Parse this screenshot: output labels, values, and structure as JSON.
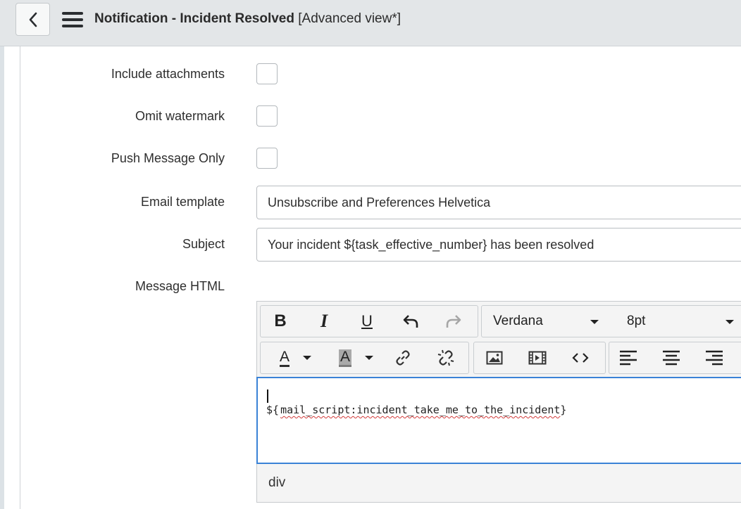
{
  "header": {
    "title": "Notification - Incident Resolved",
    "view": "[Advanced view*]",
    "back_icon": "chevron-left-icon",
    "menu_icon": "hamburger-menu-icon"
  },
  "form": {
    "include_attachments": {
      "label": "Include attachments",
      "checked": false
    },
    "omit_watermark": {
      "label": "Omit watermark",
      "checked": false
    },
    "push_message_only": {
      "label": "Push Message Only",
      "checked": false
    },
    "email_template": {
      "label": "Email template",
      "value": "Unsubscribe and Preferences Helvetica"
    },
    "subject": {
      "label": "Subject",
      "value": "Your incident ${task_effective_number} has been resolved"
    },
    "message_html": {
      "label": "Message HTML"
    }
  },
  "editor": {
    "font_family": "Verdana",
    "font_size": "8pt",
    "toolbar_icons": [
      "bold-icon",
      "italic-icon",
      "underline-icon",
      "undo-icon",
      "redo-icon",
      "text-color-icon",
      "background-color-icon",
      "link-icon",
      "unlink-icon",
      "image-icon",
      "video-icon",
      "source-code-icon",
      "align-left-icon",
      "align-center-icon",
      "align-right-icon"
    ],
    "bold_glyph": "B",
    "italic_glyph": "I",
    "underline_glyph": "U",
    "text_color_glyph": "A",
    "bg_color_glyph": "A",
    "content": "${mail_script:incident_take_me_to_the_incident}",
    "path": "div"
  },
  "colors": {
    "header_bg": "#e3e6e8",
    "focus_border": "#3a82d6",
    "spellcheck": "#d23b3b"
  }
}
